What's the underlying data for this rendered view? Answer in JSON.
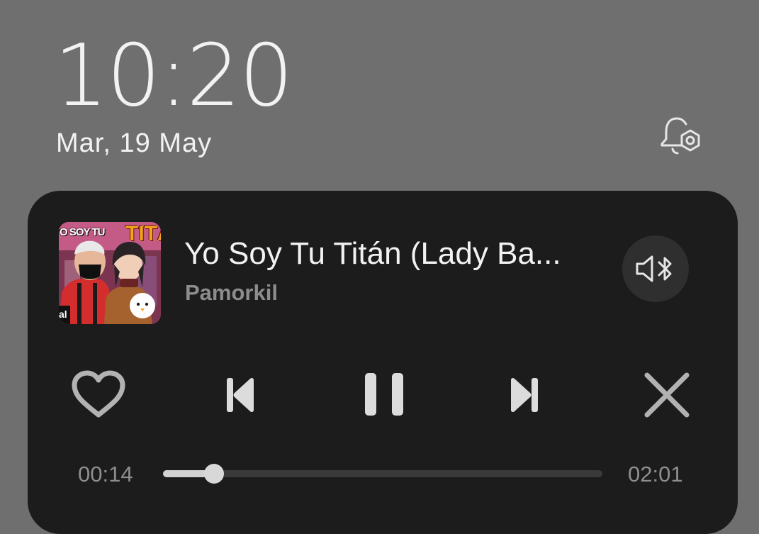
{
  "lockscreen": {
    "time": "10:20",
    "date": "Mar, 19 May"
  },
  "media": {
    "title": "Yo Soy Tu Titán (Lady Ba...",
    "artist": "Pamorkil",
    "album_art": {
      "text_left": "YO SOY TU",
      "text_right": "TITÁN",
      "corner": "al"
    },
    "elapsed": "00:14",
    "duration": "02:01",
    "progress": 0.1157
  },
  "icons": {
    "notification_settings": "bell-settings-icon",
    "output_device": "speaker-bluetooth-icon",
    "favorite": "heart-outline-icon",
    "previous": "skip-previous-icon",
    "play_pause": "pause-icon",
    "next": "skip-next-icon",
    "close": "close-icon"
  },
  "colors": {
    "background": "#6f6f6f",
    "card": "#1c1c1c",
    "progress_fill": "#d2d2d2",
    "progress_track": "#3a3a3a",
    "secondary_text": "#8d8d8d"
  }
}
